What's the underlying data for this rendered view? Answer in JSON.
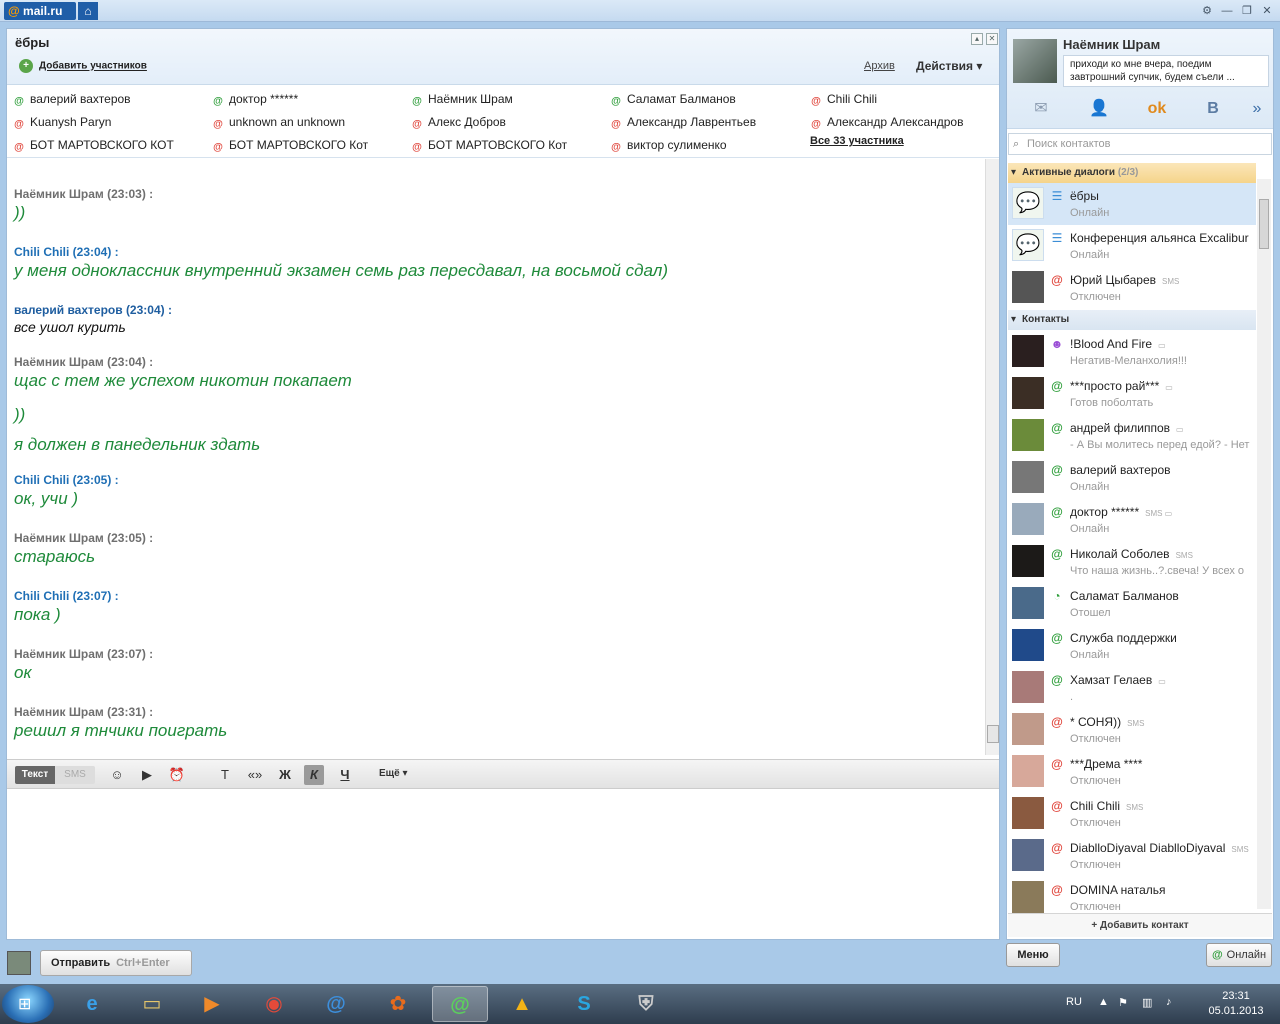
{
  "app": {
    "logo": "mail.ru",
    "logo_at": "@"
  },
  "chat": {
    "title": "ёбры",
    "add_participants": "Добавить участников",
    "archive": "Архив",
    "actions": "Действия",
    "all_participants": "Все 33 участника",
    "participants": [
      {
        "name": "валерий вахтеров",
        "status": "online"
      },
      {
        "name": "доктор ******",
        "status": "online"
      },
      {
        "name": "Наёмник Шрам",
        "status": "online"
      },
      {
        "name": "Саламат Балманов",
        "status": "away"
      },
      {
        "name": "Chili Chili",
        "status": "offline"
      },
      {
        "name": "Kuanysh Paryn",
        "status": "offline"
      },
      {
        "name": "unknown an unknown",
        "status": "offline"
      },
      {
        "name": "Алекс Добров",
        "status": "offline"
      },
      {
        "name": "Александр  Лаврентьев",
        "status": "offline"
      },
      {
        "name": "Александр Александров",
        "status": "offline"
      },
      {
        "name": "БОТ МАРТОВСКОГО КОТ",
        "status": "offline"
      },
      {
        "name": "БОТ МАРТОВСКОГО Кот",
        "status": "offline"
      },
      {
        "name": "БОТ МАРТОВСКОГО Кот",
        "status": "offline"
      },
      {
        "name": "виктор сулименко",
        "status": "offline"
      }
    ],
    "messages": [
      {
        "author": "Наёмник Шрам (23:03) :",
        "text": "))"
      },
      {
        "author": "Chili Chili (23:04) :",
        "text": "у меня одноклассник внутренний экзамен семь раз пересдавал, на восьмой сдал)"
      },
      {
        "author": "валерий вахтеров (23:04) :",
        "text": "все ушол курить"
      },
      {
        "author": "Наёмник Шрам (23:04) :",
        "text": "щас с тем же успехом никотин покапает"
      },
      {
        "author": "",
        "text": "))"
      },
      {
        "author": "",
        "text": "я должен в панедельник здать"
      },
      {
        "author": "Chili Chili (23:05) :",
        "text": "ок, учи )"
      },
      {
        "author": "Наёмник Шрам (23:05) :",
        "text": "стараюсь"
      },
      {
        "author": "Chili Chili (23:07) :",
        "text": "пока )"
      },
      {
        "author": "Наёмник Шрам (23:07) :",
        "text": "ок"
      },
      {
        "author": "Наёмник Шрам (23:31) :",
        "text": "решил я тнчики поиграть"
      }
    ]
  },
  "toolbar": {
    "tab_text": "Текст",
    "tab_sms": "SMS",
    "bold": "Ж",
    "italic": "К",
    "underline": "Ч",
    "quote": "«»",
    "more": "Ещё"
  },
  "send": {
    "label": "Отправить",
    "hint": "Ctrl+Enter"
  },
  "profile": {
    "name": "Наёмник Шрам",
    "status": "приходи ко мне вчера, поедим завтрошний супчик, будем съели ..."
  },
  "contacts_panel": {
    "search_placeholder": "Поиск контактов",
    "active_header": "Активные диалоги",
    "active_count": "(2/3)",
    "contacts_header": "Контакты",
    "add_contact": "+ Добавить контакт",
    "active": [
      {
        "name": "ёбры",
        "sub": "Онлайн",
        "tag": ""
      },
      {
        "name": "Конференция альянса Excalibur",
        "sub": "Онлайн",
        "tag": ""
      },
      {
        "name": "Юрий Цыбарев",
        "sub": "Отключен",
        "tag": "SMS"
      }
    ],
    "contacts": [
      {
        "name": "!Blood And Fire",
        "sub": "Негатив-Меланхолия!!!",
        "tag": "▭"
      },
      {
        "name": "***просто рай***",
        "sub": "Готов поболтать",
        "tag": "▭"
      },
      {
        "name": "андрей филиппов",
        "sub": "- А Вы молитесь перед едой? - Нет",
        "tag": "▭"
      },
      {
        "name": "валерий вахтеров",
        "sub": "Онлайн",
        "tag": ""
      },
      {
        "name": "доктор ******",
        "sub": "Онлайн",
        "tag": "SMS ▭"
      },
      {
        "name": "Николай Соболев",
        "sub": "Что наша жизнь..?.свеча! У всех о",
        "tag": "SMS"
      },
      {
        "name": "Саламат Балманов",
        "sub": "Отошел",
        "tag": ""
      },
      {
        "name": "Служба поддержки",
        "sub": "Онлайн",
        "tag": ""
      },
      {
        "name": "Хамзат Гелаев",
        "sub": ".",
        "tag": "▭"
      },
      {
        "name": "* СОНЯ))",
        "sub": "Отключен",
        "tag": "SMS"
      },
      {
        "name": "***Дрема ****",
        "sub": "Отключен",
        "tag": ""
      },
      {
        "name": "Chili Chili",
        "sub": "Отключен",
        "tag": "SMS"
      },
      {
        "name": "DiablloDiyaval DiablloDiyaval",
        "sub": "Отключен",
        "tag": "SMS"
      },
      {
        "name": "DOMINA наталья",
        "sub": "Отключен",
        "tag": ""
      }
    ]
  },
  "bottom": {
    "menu": "Меню",
    "online": "Онлайн"
  },
  "taskbar": {
    "lang": "RU",
    "time": "23:31",
    "date": "05.01.2013"
  }
}
